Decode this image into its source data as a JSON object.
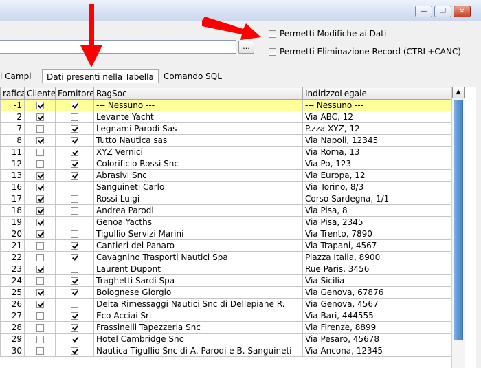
{
  "window": {
    "minimize_glyph": "—",
    "restore_glyph": "❐",
    "close_glyph": "✕"
  },
  "toolbar": {
    "browse_label": "..."
  },
  "options": {
    "allow_edit_label": "Permetti Modifiche ai Dati",
    "allow_delete_label": "Permetti Eliminazione Record (CTRL+CANC)"
  },
  "tabs": [
    {
      "label": "i Campi"
    },
    {
      "label": "Dati presenti nella Tabella"
    },
    {
      "label": "Comando SQL"
    }
  ],
  "grid": {
    "columns": [
      "rafica",
      "Cliente",
      "Fornitore",
      "RagSoc",
      "IndirizzoLegale"
    ],
    "sort_glyph": "▲",
    "rows": [
      {
        "id": "-1",
        "cliente": true,
        "fornitore": true,
        "ragsoc": "--- Nessuno ---",
        "indirizzo": "--- Nessuno ---"
      },
      {
        "id": "2",
        "cliente": true,
        "fornitore": false,
        "ragsoc": "Levante Yacht",
        "indirizzo": "Via ABC, 12"
      },
      {
        "id": "7",
        "cliente": false,
        "fornitore": true,
        "ragsoc": "Legnami Parodi Sas",
        "indirizzo": "P.zza XYZ, 12"
      },
      {
        "id": "8",
        "cliente": true,
        "fornitore": true,
        "ragsoc": "Tutto Nautica sas",
        "indirizzo": "Via Napoli, 12345"
      },
      {
        "id": "11",
        "cliente": false,
        "fornitore": true,
        "ragsoc": "XYZ Vernici",
        "indirizzo": "Via Roma, 13"
      },
      {
        "id": "12",
        "cliente": false,
        "fornitore": true,
        "ragsoc": "Colorificio Rossi Snc",
        "indirizzo": "Via Po, 123"
      },
      {
        "id": "13",
        "cliente": true,
        "fornitore": true,
        "ragsoc": "Abrasivi Snc",
        "indirizzo": "Via Europa, 12"
      },
      {
        "id": "16",
        "cliente": true,
        "fornitore": false,
        "ragsoc": "Sanguineti Carlo",
        "indirizzo": "Via Torino, 8/3"
      },
      {
        "id": "17",
        "cliente": true,
        "fornitore": false,
        "ragsoc": "Rossi Luigi",
        "indirizzo": "Corso Sardegna, 1/1"
      },
      {
        "id": "18",
        "cliente": true,
        "fornitore": false,
        "ragsoc": "Andrea Parodi",
        "indirizzo": "Via Pisa, 8"
      },
      {
        "id": "19",
        "cliente": true,
        "fornitore": false,
        "ragsoc": "Genoa Yacths",
        "indirizzo": "Via Pisa, 2345"
      },
      {
        "id": "20",
        "cliente": true,
        "fornitore": false,
        "ragsoc": "Tigullio Servizi Marini",
        "indirizzo": "Via Trento, 7890"
      },
      {
        "id": "21",
        "cliente": false,
        "fornitore": true,
        "ragsoc": "Cantieri del Panaro",
        "indirizzo": "Via Trapani, 4567"
      },
      {
        "id": "22",
        "cliente": false,
        "fornitore": true,
        "ragsoc": "Cavagnino Trasporti Nautici Spa",
        "indirizzo": "Piazza Italia, 8900"
      },
      {
        "id": "23",
        "cliente": true,
        "fornitore": false,
        "ragsoc": "Laurent Dupont",
        "indirizzo": "Rue Paris, 3456"
      },
      {
        "id": "24",
        "cliente": false,
        "fornitore": true,
        "ragsoc": "Traghetti Sardi Spa",
        "indirizzo": "Via Sicilia"
      },
      {
        "id": "25",
        "cliente": true,
        "fornitore": true,
        "ragsoc": "Bolognese Giorgio",
        "indirizzo": "Via Genova, 67876"
      },
      {
        "id": "26",
        "cliente": true,
        "fornitore": false,
        "ragsoc": "Delta Rimessaggi Nautici Snc di Dellepiane R.",
        "indirizzo": "Via Genova, 4567"
      },
      {
        "id": "27",
        "cliente": false,
        "fornitore": true,
        "ragsoc": "Eco Acciai Srl",
        "indirizzo": "Via Bari, 444555"
      },
      {
        "id": "28",
        "cliente": false,
        "fornitore": true,
        "ragsoc": "Frassinelli Tapezzeria Snc",
        "indirizzo": "Via Firenze, 8899"
      },
      {
        "id": "29",
        "cliente": false,
        "fornitore": true,
        "ragsoc": "Hotel Cambridge Snc",
        "indirizzo": "Via Pesaro, 45678"
      },
      {
        "id": "30",
        "cliente": false,
        "fornitore": true,
        "ragsoc": "Nautica Tigullio Snc di A. Parodi e B. Sanguineti",
        "indirizzo": "Via Ancona, 12345"
      }
    ]
  },
  "colors": {
    "selected_row": "#ffff99",
    "arrow": "#ff0000",
    "scroll_thumb": "#5d95d6"
  }
}
